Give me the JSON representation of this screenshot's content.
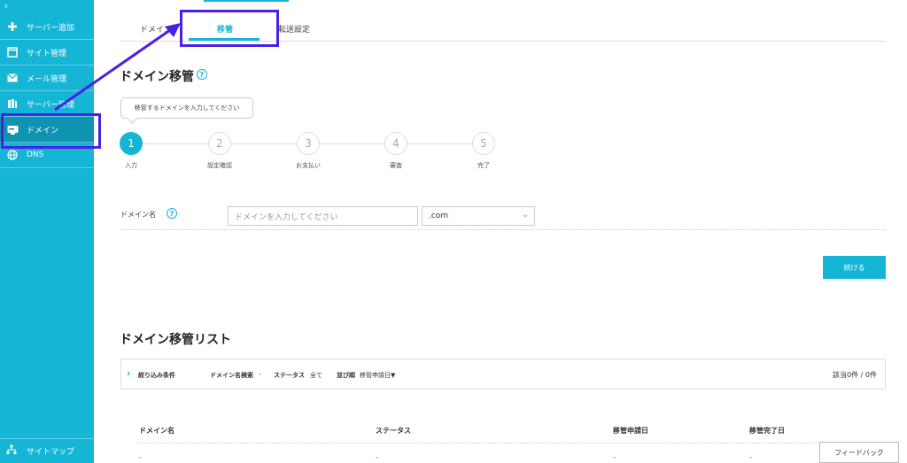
{
  "sidebar": {
    "collapse_glyph": "‹",
    "items": [
      {
        "label": "サーバー追加",
        "icon": "plus-icon"
      },
      {
        "label": "サイト管理",
        "icon": "window-icon"
      },
      {
        "label": "メール管理",
        "icon": "mail-icon"
      },
      {
        "label": "サーバー管理",
        "icon": "server-icon"
      },
      {
        "label": "ドメイン",
        "icon": "domain-icon"
      },
      {
        "label": "DNS",
        "icon": "globe-icon"
      }
    ],
    "sitemap_label": "サイトマップ"
  },
  "tabs": [
    {
      "label": "ドメイン"
    },
    {
      "label": "移管"
    },
    {
      "label": "転送設定"
    }
  ],
  "section_title": "ドメイン移管",
  "help_glyph": "?",
  "tooltip": "移管するドメインを入力してください",
  "steps": [
    {
      "number": "1",
      "label": "入力"
    },
    {
      "number": "2",
      "label": "設定確認"
    },
    {
      "number": "3",
      "label": "お支払い"
    },
    {
      "number": "4",
      "label": "審査"
    },
    {
      "number": "5",
      "label": "完了"
    }
  ],
  "form": {
    "domain_label": "ドメイン名",
    "domain_placeholder": "ドメインを入力してください",
    "tld_value": ".com",
    "continue_label": "続ける"
  },
  "list": {
    "title": "ドメイン移管リスト",
    "filter": {
      "toggle_label": "絞り込み条件",
      "search_label": "ドメイン名検索",
      "search_value": "-",
      "status_label": "ステータス",
      "status_value": "全て",
      "sort_label": "並び順",
      "sort_value": "移管申請日▼",
      "count": "該当0件 / 0件"
    },
    "columns": [
      "ドメイン名",
      "ステータス",
      "移管申請日",
      "移管完了日"
    ],
    "row": [
      "-",
      "-",
      "-",
      "-"
    ]
  },
  "feedback_label": "フィードバック",
  "colors": {
    "accent": "#15b5d6",
    "sidebar_active": "#0e93b0",
    "annotation": "#4a1fe6"
  }
}
